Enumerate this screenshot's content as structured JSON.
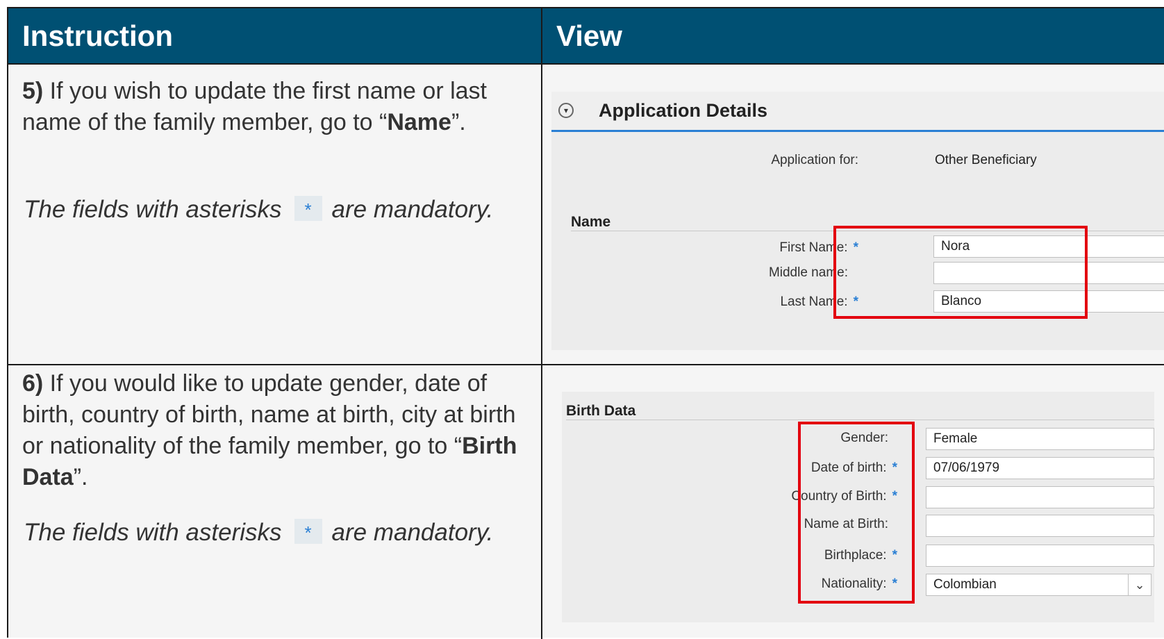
{
  "headers": {
    "instruction": "Instruction",
    "view": "View"
  },
  "step5": {
    "num": "5)",
    "text_before": " If you wish to update the first name or last name of the family member, go to “",
    "target": "Name",
    "text_after": "”.",
    "note_before": "The fields with asterisks",
    "note_after": "are mandatory."
  },
  "step6": {
    "num": "6)",
    "text_before": " If you would like to update gender, date of birth, country of birth, name at birth, city at birth or nationality of the family member, go to “",
    "target": "Birth Data",
    "text_after": "”.",
    "note_before": "The fields with asterisks",
    "note_after": "are mandatory."
  },
  "asterisk": "*",
  "app_details": {
    "title": "Application Details",
    "application_for_label": "Application for:",
    "application_for_value": "Other Beneficiary",
    "name_section": "Name",
    "first_name_label": "First Name:",
    "first_name_value": "Nora",
    "middle_name_label": "Middle name:",
    "middle_name_value": "",
    "last_name_label": "Last Name:",
    "last_name_value": "Blanco"
  },
  "birth_data": {
    "section": "Birth Data",
    "gender_label": "Gender:",
    "gender_value": "Female",
    "dob_label": "Date of birth:",
    "dob_value": "07/06/1979",
    "country_label": "Country of Birth:",
    "country_value": "",
    "name_at_birth_label": "Name at Birth:",
    "name_at_birth_value": "",
    "birthplace_label": "Birthplace:",
    "birthplace_value": "",
    "nationality_label": "Nationality:",
    "nationality_value": "Colombian"
  },
  "colors": {
    "header_bg": "#005073",
    "highlight": "#e3000f",
    "accent": "#2a7fd4"
  },
  "icons": {
    "collapse": "chevron-down-circle-icon",
    "dropdown": "chevron-down-icon"
  }
}
